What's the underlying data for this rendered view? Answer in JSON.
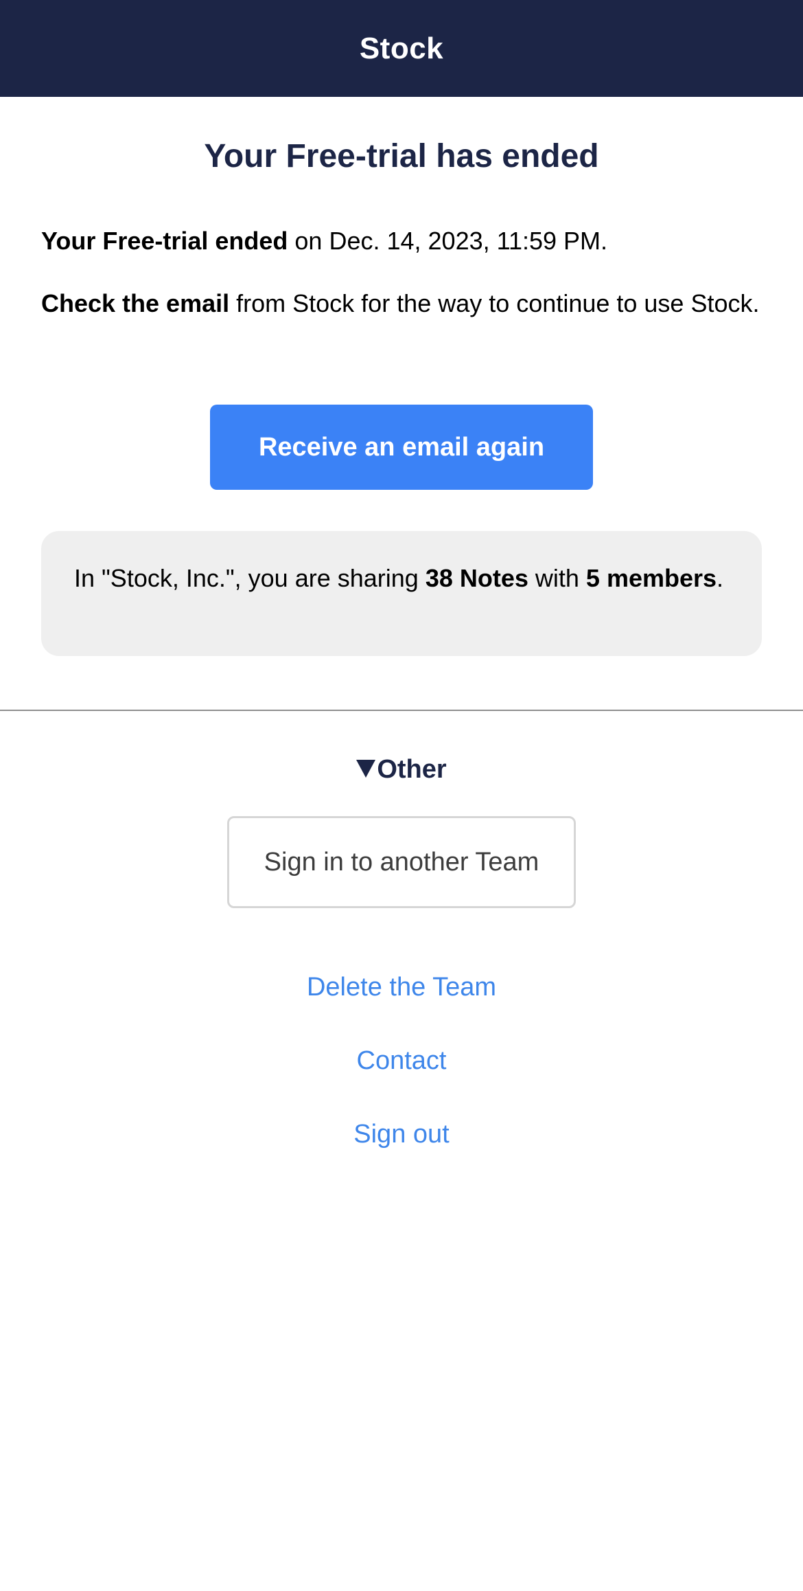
{
  "header": {
    "title": "Stock"
  },
  "main": {
    "title": "Your Free-trial has ended",
    "trial_ended": {
      "bold": "Your Free-trial ended",
      "rest": " on Dec. 14, 2023, 11:59 PM."
    },
    "check_email": {
      "bold": "Check the email",
      "rest": " from Stock for the way to continue to use Stock."
    },
    "receive_button_label": "Receive an email again"
  },
  "info_box": {
    "prefix": "In \"Stock, Inc.\", you are sharing ",
    "notes": "38 Notes",
    "middle": " with ",
    "members": "5 members",
    "suffix": "."
  },
  "other": {
    "toggle_label": "Other",
    "toggle_icon": "triangle-down-icon",
    "sign_in_button_label": "Sign in to another Team",
    "links": {
      "delete_team": "Delete the Team",
      "contact": "Contact",
      "sign_out": "Sign out"
    }
  },
  "colors": {
    "header_bg": "#1c2546",
    "primary_button": "#3b82f6",
    "link": "#3e86ea",
    "info_box_bg": "#efefef"
  }
}
